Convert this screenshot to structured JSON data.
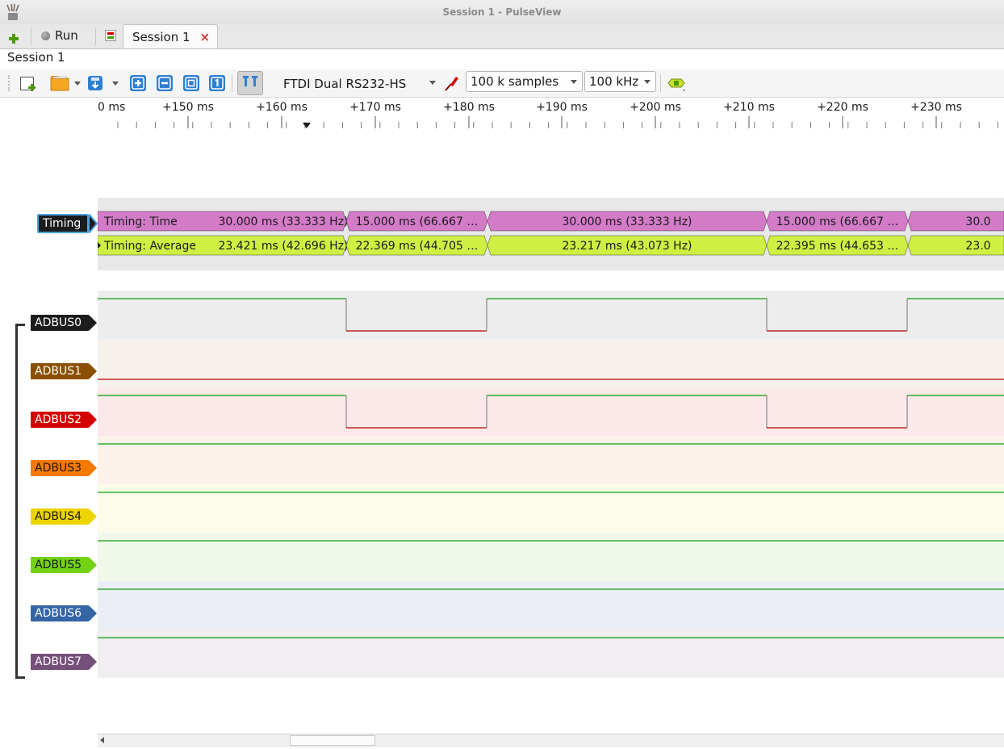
{
  "window": {
    "title": "Session 1 - PulseView"
  },
  "tabbar": {
    "run_label": "Run",
    "session_tab_label": "Session 1",
    "close_glyph": "×"
  },
  "session": {
    "label": "Session 1"
  },
  "toolbar": {
    "device": "FTDI Dual RS232-HS",
    "samples": "100 k samples",
    "samplerate": "100 kHz",
    "icons": [
      "new-view-icon",
      "open-icon",
      "save-icon",
      "zoom-in-icon",
      "zoom-out-icon",
      "zoom-fit-icon",
      "zoom-one-to-one-icon",
      "cursors-icon",
      "probe-icon",
      "decoder-icon"
    ]
  },
  "ruler": {
    "ticks": [
      {
        "label": "0 ms",
        "major": true
      },
      {
        "label": "+150 ms",
        "major": true
      },
      {
        "label": "+160 ms",
        "major": true
      },
      {
        "label": "+170 ms",
        "major": true
      },
      {
        "label": "+180 ms",
        "major": true
      },
      {
        "label": "+190 ms",
        "major": true
      },
      {
        "label": "+200 ms",
        "major": true
      },
      {
        "label": "+210 ms",
        "major": true
      },
      {
        "label": "+220 ms",
        "major": true
      },
      {
        "label": "+230 ms",
        "major": true
      }
    ]
  },
  "decoder": {
    "label": "Timing",
    "rows": [
      {
        "title": "Timing: Time",
        "color": "#d47bc8",
        "segments": [
          "30.000 ms (33.333 Hz)",
          "15.000 ms (66.667 …",
          "30.000 ms (33.333 Hz)",
          "15.000 ms (66.667 …",
          "30.0"
        ]
      },
      {
        "title": "Timing: Average",
        "color": "#cff043",
        "segments": [
          "23.421 ms (42.696 Hz)",
          "22.369 ms (44.705 …",
          "23.217 ms (43.073 Hz)",
          "22.395 ms (44.653 …",
          "23.0"
        ]
      }
    ]
  },
  "channels": [
    {
      "name": "ADBUS0",
      "tag_color": "#1c1c1c",
      "text_color": "#ffffff",
      "bg": "#ededed",
      "signal": "toggle"
    },
    {
      "name": "ADBUS1",
      "tag_color": "#8a4f00",
      "text_color": "#ffffff",
      "bg": "#f6f1eb",
      "signal": "low"
    },
    {
      "name": "ADBUS2",
      "tag_color": "#d40000",
      "text_color": "#ffffff",
      "bg": "#fbe8e8",
      "signal": "toggle"
    },
    {
      "name": "ADBUS3",
      "tag_color": "#f57900",
      "text_color": "#1a1a1a",
      "bg": "#fdf2e9",
      "signal": "high"
    },
    {
      "name": "ADBUS4",
      "tag_color": "#edd400",
      "text_color": "#1a1a1a",
      "bg": "#fdfce9",
      "signal": "high"
    },
    {
      "name": "ADBUS5",
      "tag_color": "#73d216",
      "text_color": "#1a1a1a",
      "bg": "#f0f8ea",
      "signal": "high"
    },
    {
      "name": "ADBUS6",
      "tag_color": "#3465a4",
      "text_color": "#ffffff",
      "bg": "#ebeff5",
      "signal": "high"
    },
    {
      "name": "ADBUS7",
      "tag_color": "#75507b",
      "text_color": "#ffffff",
      "bg": "#f0eef1",
      "signal": "high"
    }
  ]
}
